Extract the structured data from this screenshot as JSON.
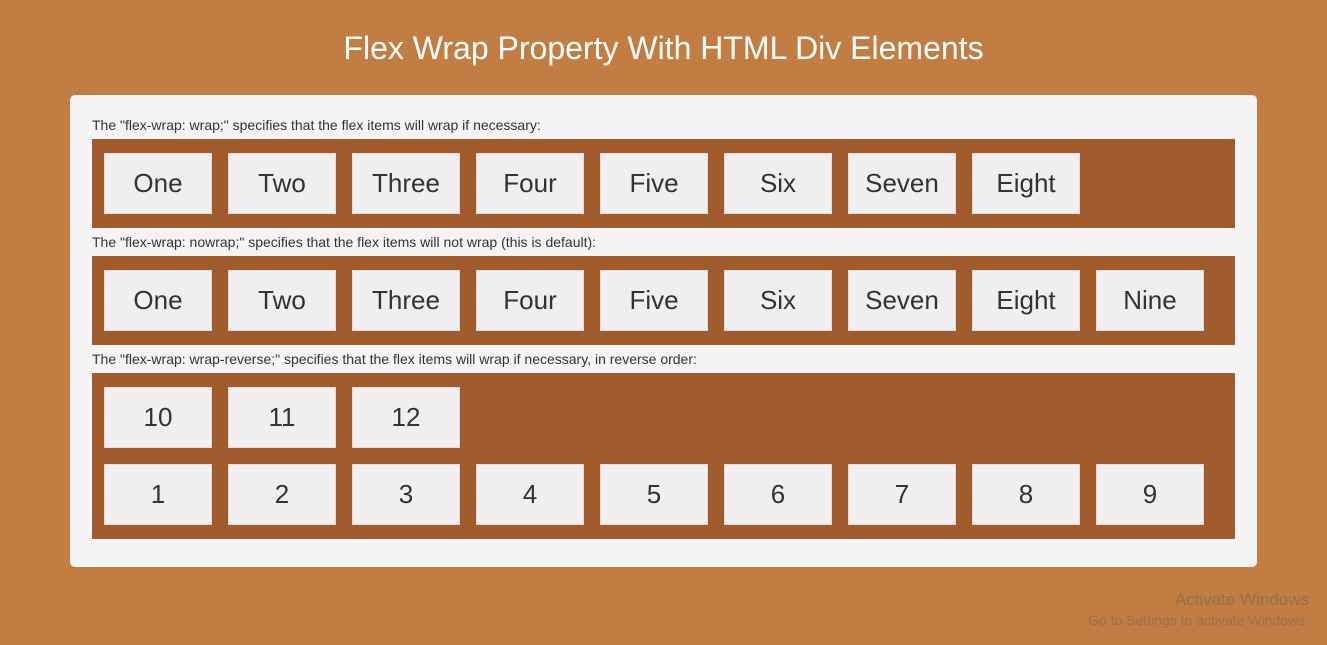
{
  "title": "Flex Wrap Property With HTML Div Elements",
  "section1": {
    "description": "The \"flex-wrap: wrap;\" specifies that the flex items will wrap if necessary:",
    "items": [
      "One",
      "Two",
      "Three",
      "Four",
      "Five",
      "Six",
      "Seven",
      "Eight"
    ]
  },
  "section2": {
    "description": "The \"flex-wrap: nowrap;\" specifies that the flex items will not wrap (this is default):",
    "items": [
      "One",
      "Two",
      "Three",
      "Four",
      "Five",
      "Six",
      "Seven",
      "Eight",
      "Nine"
    ]
  },
  "section3": {
    "description": "The \"flex-wrap: wrap-reverse;\" specifies that the flex items will wrap if necessary, in reverse order:",
    "items": [
      "1",
      "2",
      "3",
      "4",
      "5",
      "6",
      "7",
      "8",
      "9",
      "10",
      "11",
      "12"
    ]
  },
  "watermark": {
    "line1": "Activate Windows",
    "line2": "Go to Settings to activate Windows."
  }
}
